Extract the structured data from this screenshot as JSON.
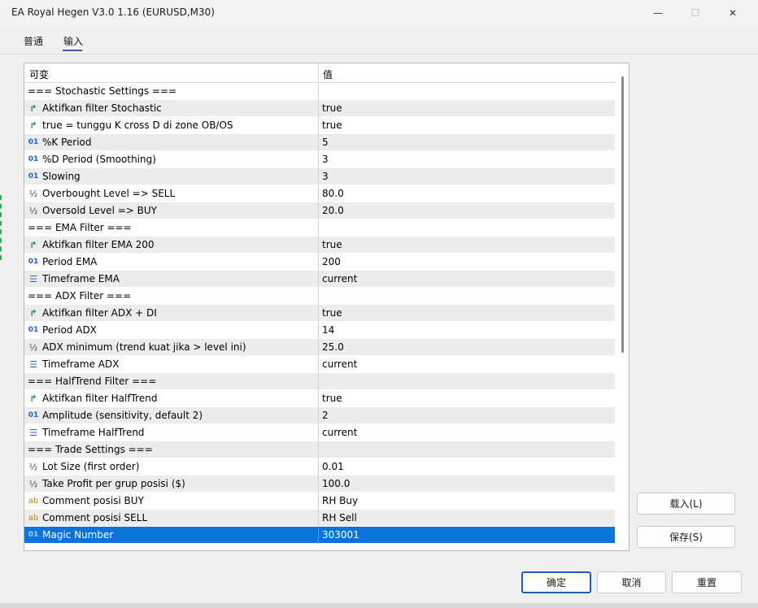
{
  "window": {
    "title": "EA Royal Hegen V3.0 1.16 (EURUSD,M30)",
    "minimize_glyph": "—",
    "maximize_glyph": "☐",
    "close_glyph": "✕"
  },
  "tabs": [
    {
      "label": "普通"
    },
    {
      "label": "输入"
    }
  ],
  "grid": {
    "columns": [
      "可变",
      "值"
    ],
    "rows": [
      {
        "icon": "",
        "name": "=== Stochastic Settings ===",
        "value": ""
      },
      {
        "icon": "bool-arrow-icon",
        "name": "Aktifkan filter Stochastic",
        "value": "true"
      },
      {
        "icon": "bool-arrow-icon",
        "name": "true  = tunggu K cross D di zone OB/OS",
        "value": "true"
      },
      {
        "icon": "integer-icon",
        "name": "%K Period",
        "value": "5"
      },
      {
        "icon": "integer-icon",
        "name": "%D Period (Smoothing)",
        "value": "3"
      },
      {
        "icon": "integer-icon",
        "name": "Slowing",
        "value": "3"
      },
      {
        "icon": "double-icon",
        "name": "Overbought Level => SELL",
        "value": "80.0"
      },
      {
        "icon": "double-icon",
        "name": "Oversold Level  => BUY",
        "value": "20.0"
      },
      {
        "icon": "",
        "name": "=== EMA Filter ===",
        "value": ""
      },
      {
        "icon": "bool-arrow-icon",
        "name": "Aktifkan filter EMA 200",
        "value": "true"
      },
      {
        "icon": "integer-icon",
        "name": "Period EMA",
        "value": "200"
      },
      {
        "icon": "enum-icon",
        "name": "Timeframe EMA",
        "value": "current"
      },
      {
        "icon": "",
        "name": "=== ADX Filter ===",
        "value": ""
      },
      {
        "icon": "bool-arrow-icon",
        "name": "Aktifkan filter ADX + DI",
        "value": "true"
      },
      {
        "icon": "integer-icon",
        "name": "Period ADX",
        "value": "14"
      },
      {
        "icon": "double-icon",
        "name": "ADX minimum (trend kuat jika > level ini)",
        "value": "25.0"
      },
      {
        "icon": "enum-icon",
        "name": "Timeframe ADX",
        "value": "current"
      },
      {
        "icon": "",
        "name": "=== HalfTrend Filter ===",
        "value": ""
      },
      {
        "icon": "bool-arrow-icon",
        "name": "Aktifkan filter HalfTrend",
        "value": "true"
      },
      {
        "icon": "integer-icon",
        "name": "Amplitude (sensitivity, default 2)",
        "value": "2"
      },
      {
        "icon": "enum-icon",
        "name": "Timeframe HalfTrend",
        "value": "current"
      },
      {
        "icon": "",
        "name": "=== Trade Settings ===",
        "value": ""
      },
      {
        "icon": "double-icon",
        "name": "Lot Size (first order)",
        "value": "0.01"
      },
      {
        "icon": "double-icon",
        "name": "Take Profit per grup posisi ($)",
        "value": "100.0"
      },
      {
        "icon": "string-icon",
        "name": "Comment posisi BUY",
        "value": "RH Buy"
      },
      {
        "icon": "string-icon",
        "name": "Comment posisi SELL",
        "value": "RH Sell"
      },
      {
        "icon": "integer-icon",
        "name": "Magic Number",
        "value": "303001",
        "selected": true
      }
    ],
    "selected_color": "#0a74da"
  },
  "buttons": {
    "load": "载入(L)",
    "save": "保存(S)",
    "ok": "确定",
    "cancel": "取消",
    "reset": "重置"
  },
  "icon_glyphs": {
    "bool-arrow-icon": "↱",
    "integer-icon": "01",
    "double-icon": "½",
    "enum-icon": "☰",
    "string-icon": "ab"
  }
}
